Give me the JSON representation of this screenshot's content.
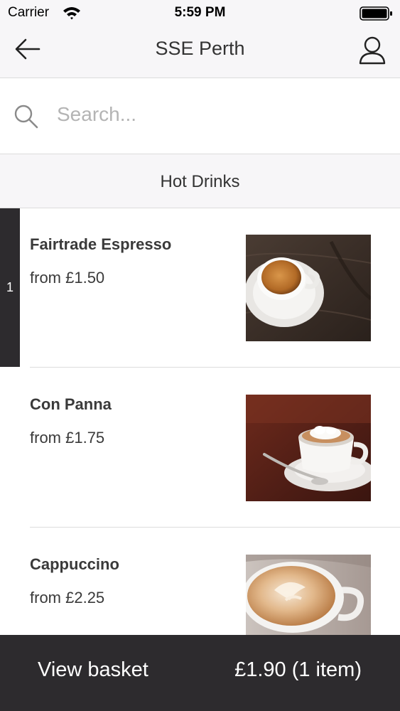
{
  "status_bar": {
    "carrier": "Carrier",
    "time": "5:59 PM"
  },
  "nav": {
    "title": "SSE Perth",
    "back_icon": "arrow-left-icon",
    "profile_icon": "user-icon"
  },
  "search": {
    "placeholder": "Search...",
    "value": ""
  },
  "category": {
    "label": "Hot Drinks"
  },
  "products": [
    {
      "name": "Fairtrade Espresso",
      "price": "from £1.50",
      "quantity": "1",
      "image": "espresso-photo"
    },
    {
      "name": "Con Panna",
      "price": "from £1.75",
      "image": "con-panna-photo"
    },
    {
      "name": "Cappuccino",
      "price": "from £2.25",
      "image": "cappuccino-photo"
    }
  ],
  "basket": {
    "label": "View basket",
    "total": "£1.90 (1 item)"
  },
  "colors": {
    "dark_bar": "#2d2b2e",
    "header_bg": "#f7f6f8",
    "divider": "#dcdcdc",
    "placeholder": "#b4b4b4"
  }
}
